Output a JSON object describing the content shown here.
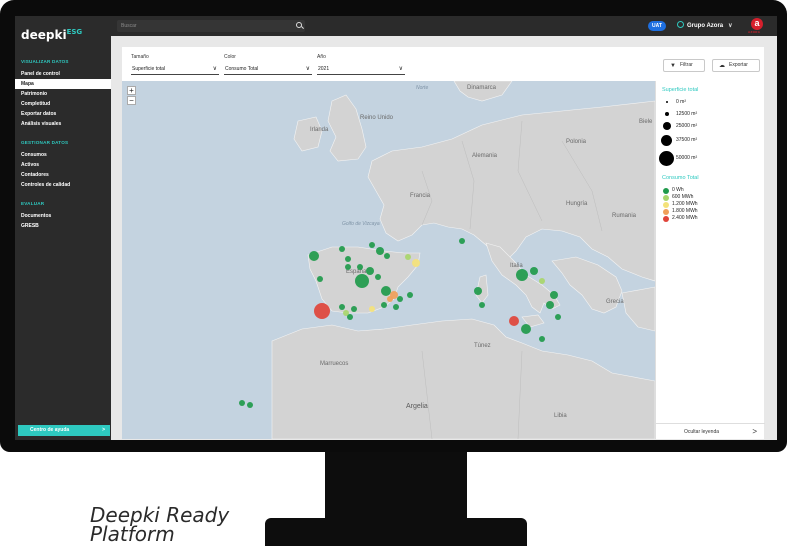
{
  "sidebar": {
    "logo": "deepki",
    "logo_sup": "ESG",
    "sections": [
      {
        "title": "VISUALIZAR DATOS",
        "items": [
          "Panel de control",
          "Mapa",
          "Patrimonio",
          "Completitud",
          "Exportar datos",
          "Análisis visuales"
        ]
      },
      {
        "title": "GESTIONAR DATOS",
        "items": [
          "Consumos",
          "Activos",
          "Contadores",
          "Controles de calidad"
        ]
      },
      {
        "title": "EVALUAR",
        "items": [
          "Documentos",
          "GRESB"
        ]
      }
    ],
    "active_item": "Mapa",
    "help_label": "Centro de ayuda",
    "help_chevron": ">"
  },
  "topbar": {
    "search_placeholder": "Buscar",
    "env_badge": "UAT",
    "org_name": "Grupo Azora",
    "org_chevron": "∨",
    "brand_letter": "a",
    "brand_text": "AZORA"
  },
  "filters": {
    "tamano_label": "Tamaño",
    "tamano_value": "Superficie total",
    "color_label": "Color",
    "color_value": "Consumo Total",
    "anio_label": "Año",
    "anio_value": "2021",
    "chevron": "∨",
    "filter_button": "Filtrar",
    "export_button": "Exportar",
    "filter_icon": "▼",
    "export_icon": "☁"
  },
  "map": {
    "zoom_in": "+",
    "zoom_out": "−",
    "labels": {
      "norte": "Norte",
      "irlanda": "Irlanda",
      "reino_unido": "Reino Unido",
      "dinamarca": "Dinamarca",
      "polonia": "Polonia",
      "alemania": "Alemania",
      "francia": "Francia",
      "hungria": "Hungría",
      "rumania": "Rumania",
      "espana": "España",
      "italia": "Italia",
      "grecia": "Grecia",
      "tunez": "Túnez",
      "marruecos": "Marruecos",
      "argelia": "Argelia",
      "libia": "Libia",
      "mar_golfo": "Golfo de Vizcaya",
      "bielo": "Biele"
    },
    "bubble_colors": {
      "green_dark": "#1f9a4b",
      "green_light": "#a8d66b",
      "yellow": "#f4e27a",
      "orange": "#f0a05a",
      "red": "#e0443a"
    }
  },
  "legend": {
    "size_title": "Superficie total",
    "size_items": [
      "0 m²",
      "12500 m²",
      "25000 m²",
      "37500 m²",
      "50000 m²"
    ],
    "color_title": "Consumo Total",
    "color_items": [
      {
        "label": "0 Wh",
        "color": "#1f9a4b"
      },
      {
        "label": "600 MWh",
        "color": "#a8d66b"
      },
      {
        "label": "1.200 MWh",
        "color": "#f4e27a"
      },
      {
        "label": "1.800 MWh",
        "color": "#f0a05a"
      },
      {
        "label": "2.400 MWh",
        "color": "#e0443a"
      }
    ],
    "hide_label": "Ocultar leyenda",
    "hide_chevron": ">"
  },
  "caption": {
    "line1": "Deepki Ready",
    "line2": "Platform"
  }
}
